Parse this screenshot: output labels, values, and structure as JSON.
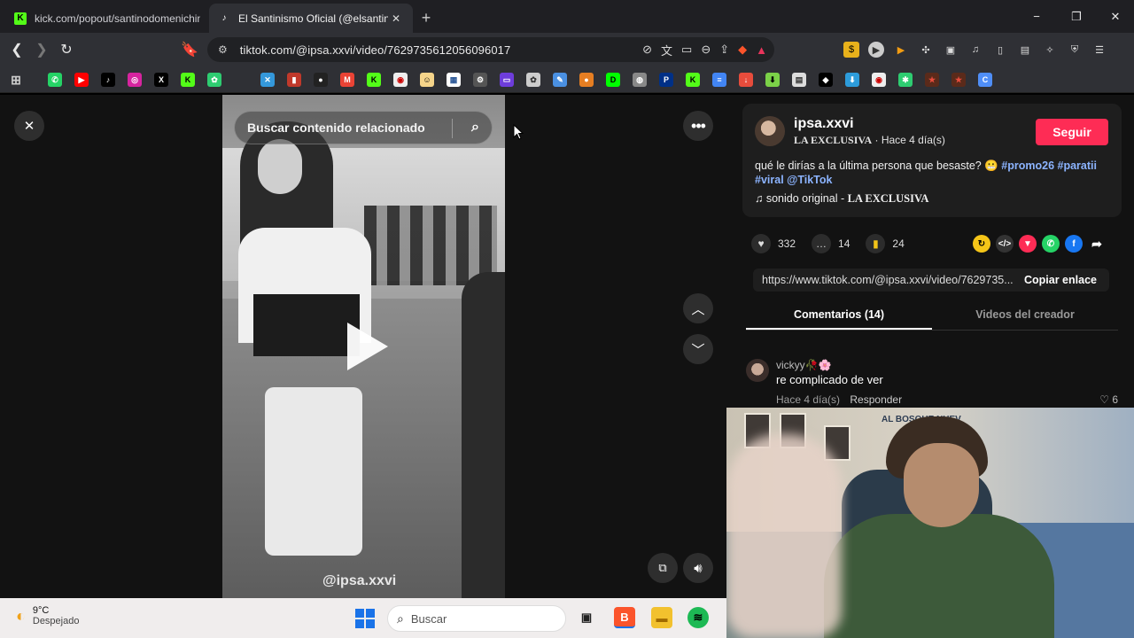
{
  "browser": {
    "tabs": [
      {
        "title": "kick.com/popout/santinodomenichin",
        "favicon": "kick-icon",
        "color": "#53fc18"
      },
      {
        "title": "El Santinismo Oficial (@elsantini",
        "favicon": "tiktok-icon",
        "color": "#ffffff"
      }
    ],
    "new_tab": "+",
    "url": "tiktok.com/@ipsa.xxvi/video/7629735612056096017",
    "window_controls": [
      "−",
      "❐",
      "✕"
    ]
  },
  "video": {
    "search_placeholder": "Buscar contenido relacionado",
    "watermark": "@ipsa.xxvi"
  },
  "post": {
    "username": "ipsa.xxvi",
    "display_name": "LA EXCLUSIVA",
    "time": "· Hace 4 día(s)",
    "follow_label": "Seguir",
    "caption": "qué le dirías a la última persona que besaste?",
    "emoji": "😬",
    "hashtags": [
      "#promo26",
      "#paratii",
      "#viral",
      "@TikTok"
    ],
    "sound_prefix": "sonido original - ",
    "sound_name": "LA EXCLUSIVA",
    "likes": "332",
    "comments": "14",
    "saves": "24",
    "link": "https://www.tiktok.com/@ipsa.xxvi/video/7629735...",
    "copy_label": "Copiar enlace",
    "tab_comments": "Comentarios (14)",
    "tab_videos": "Videos del creador",
    "accent": "#fe2c55"
  },
  "comment": {
    "author": "vickyy🥀🌸",
    "text": "re complicado de ver",
    "time": "Hace 4 día(s)",
    "reply": "Responder",
    "likes": "♡ 6"
  },
  "webcam": {
    "sign_text": "AL BOSQUE NUEV"
  },
  "taskbar": {
    "temp": "9°C",
    "weather": "Despejado",
    "search": "Buscar"
  }
}
